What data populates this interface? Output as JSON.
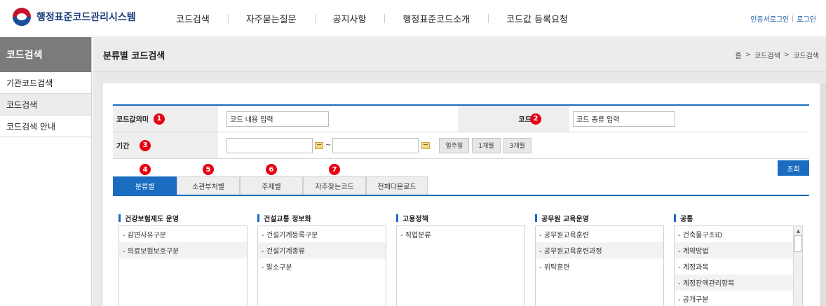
{
  "header": {
    "site_title": "행정표준코드관리시스템",
    "nav": [
      "코드검색",
      "자주묻는질문",
      "공지사항",
      "행정표준코드소개",
      "코드값 등록요청"
    ],
    "util": {
      "cert_login": "인증서로그인",
      "login": "로그인"
    }
  },
  "sidebar": {
    "title": "코드검색",
    "items": [
      {
        "label": "기관코드검색",
        "active": false
      },
      {
        "label": "코드검색",
        "active": true
      },
      {
        "label": "코드검색 안내",
        "active": false
      }
    ]
  },
  "page": {
    "title": "분류별 코드검색",
    "breadcrumb": [
      "홈",
      "코드검색",
      "코드검색"
    ]
  },
  "form": {
    "code_meaning": {
      "label": "코드값의미",
      "badge": "1",
      "placeholder": "코드 내용 입력"
    },
    "code_name": {
      "label": "코드명",
      "badge": "2",
      "placeholder": "코드 종류 입력"
    },
    "period": {
      "label": "기간",
      "badge": "3",
      "start": "",
      "tilde": "~",
      "end": "",
      "buttons": [
        "일주일",
        "1개월",
        "3개월"
      ]
    },
    "search_button": "조회"
  },
  "tabs": [
    {
      "label": "분류별",
      "badge": "4",
      "active": true
    },
    {
      "label": "소관부처별",
      "badge": "5",
      "active": false
    },
    {
      "label": "주제별",
      "badge": "6",
      "active": false
    },
    {
      "label": "자주찾는코드",
      "badge": "7",
      "active": false
    },
    {
      "label": "전체다운로드",
      "badge": "",
      "active": false
    }
  ],
  "categories": [
    {
      "title": "건강보험제도 운영",
      "items": [
        "- 감면사유구분",
        "- 의료보험보호구분"
      ]
    },
    {
      "title": "건설교통 정보화",
      "items": [
        "- 건설기계등록구분",
        "- 건설기계종류",
        "- 말소구분"
      ]
    },
    {
      "title": "고용정책",
      "items": [
        "- 직업분류"
      ]
    },
    {
      "title": "공무원 교육운영",
      "items": [
        "- 공무원교육훈련",
        "- 공무원교육훈련과정",
        "- 위탁훈련"
      ]
    },
    {
      "title": "공통",
      "items": [
        "- 건축물구조ID",
        "- 계약방법",
        "- 계정과목",
        "- 계정잔액관리항목",
        "- 공개구분"
      ]
    }
  ]
}
